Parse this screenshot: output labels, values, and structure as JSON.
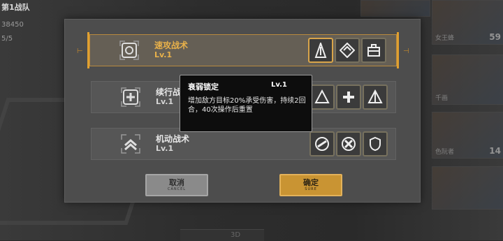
{
  "team": {
    "title": "第1战队",
    "power": "38450",
    "count": "5/5"
  },
  "roster": [
    {
      "name": "",
      "level": ""
    },
    {
      "name": "女王蜂",
      "level": "59"
    },
    {
      "name": "千画",
      "level": ""
    },
    {
      "name": "色阮者",
      "level": "14"
    },
    {
      "name": "",
      "level": ""
    }
  ],
  "tactics": [
    {
      "name": "速攻战术",
      "level": "Lv.1",
      "icon": "crosshair-icon",
      "selected": true
    },
    {
      "name": "续行战",
      "level": "Lv.1",
      "icon": "medic-cross-icon",
      "selected": false
    },
    {
      "name": "机动战术",
      "level": "Lv.1",
      "icon": "double-chevron-icon",
      "selected": false
    }
  ],
  "tooltip": {
    "title": "衰弱锁定",
    "level": "Lv.1",
    "description": "增加敌方目标20%承受伤害，持续2回合，40次操作后重置"
  },
  "buttons": {
    "cancel_label": "取消",
    "cancel_sub": "CANCEL",
    "confirm_label": "确定",
    "confirm_sub": "SURE"
  },
  "bottom": {
    "tab_3d": "3D"
  },
  "colors": {
    "accent": "#e0a030",
    "panel": "#4d4d4d",
    "tooltip_bg": "#0d0d0d"
  }
}
